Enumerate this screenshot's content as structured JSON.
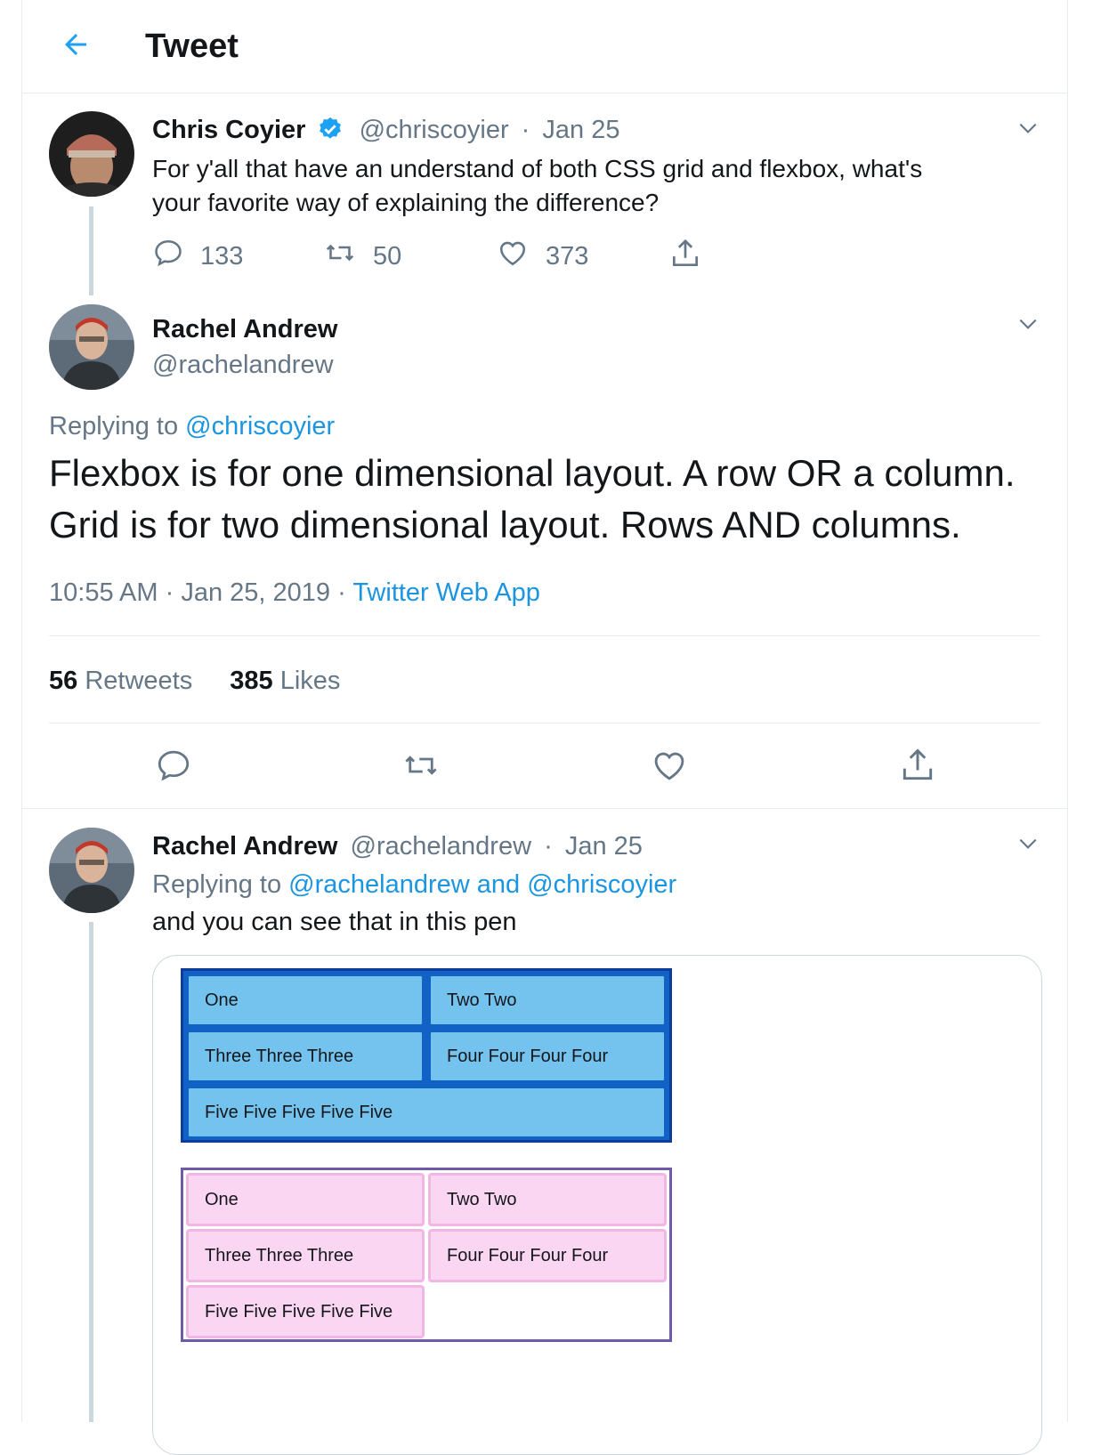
{
  "header": {
    "title": "Tweet"
  },
  "tweet1": {
    "author_name": "Chris Coyier",
    "handle": "@chriscoyier",
    "separator": "·",
    "date": "Jan 25",
    "text_line1": "For y'all that have an understand of both CSS grid and flexbox, what's",
    "text_line2": "your favorite way of explaining the difference?",
    "replies": "133",
    "retweets": "50",
    "likes": "373"
  },
  "main_tweet": {
    "author_name": "Rachel Andrew",
    "handle": "@rachelandrew",
    "replying_prefix": "Replying to",
    "replying_to": "@chriscoyier",
    "text_line1": "Flexbox is for one dimensional layout. A row OR a column.",
    "text_line2": "Grid is for two dimensional layout. Rows AND columns.",
    "time": "10:55 AM",
    "dot1": "·",
    "date": "Jan 25, 2019",
    "dot2": "·",
    "source": "Twitter Web App",
    "retweet_count": "56",
    "retweet_label": "Retweets",
    "like_count": "385",
    "like_label": "Likes"
  },
  "reply": {
    "author_name": "Rachel Andrew",
    "handle": "@rachelandrew",
    "separator": "·",
    "date": "Jan 25",
    "replying_prefix": "Replying to",
    "replying_to": "@rachelandrew and @chriscoyier",
    "text": "and you can see that in this pen",
    "grid_items": [
      "One",
      "Two Two",
      "Three Three Three",
      "Four Four Four Four",
      "Five Five Five Five Five"
    ],
    "flex_items": [
      "One",
      "Two Two",
      "Three Three Three",
      "Four Four Four Four",
      "Five Five Five Five Five"
    ]
  },
  "icons": [
    "arrow-left-icon",
    "verified-badge-icon",
    "chevron-down-icon",
    "reply-icon",
    "retweet-icon",
    "like-icon",
    "share-icon"
  ],
  "colors": {
    "accent": "#1da1f2",
    "link": "#1b95e0",
    "muted": "#657786",
    "text": "#14171a",
    "divider": "#e6ecf0",
    "grid_demo_item": "#74c2ee",
    "grid_demo_border": "#0f63c4",
    "flex_demo_item": "#fad6f2",
    "flex_demo_border": "#6e5aa8"
  }
}
